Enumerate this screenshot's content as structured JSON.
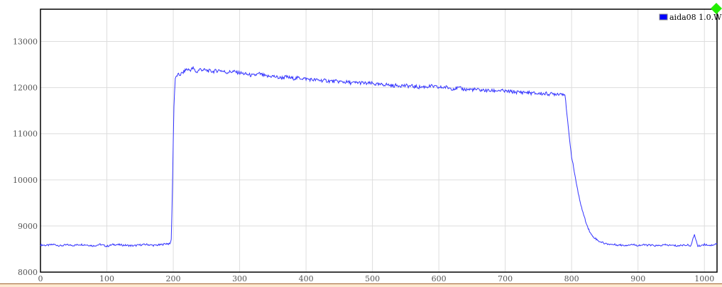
{
  "chart_data": {
    "type": "line",
    "title": "",
    "xlabel": "",
    "ylabel": "",
    "xlim": [
      0,
      1019
    ],
    "ylim": [
      8000,
      13700
    ],
    "grid": true,
    "legend_position": "top-right",
    "xticks": [
      "0",
      "100",
      "200",
      "300",
      "400",
      "500",
      "600",
      "700",
      "800",
      "900",
      "1000"
    ],
    "yticks": [
      "8000",
      "9000",
      "10000",
      "11000",
      "12000",
      "13000"
    ],
    "series": [
      {
        "name": "aida08 1.0.W",
        "color": "#3333ff",
        "x": [
          0,
          10,
          20,
          30,
          40,
          50,
          60,
          70,
          80,
          90,
          100,
          110,
          120,
          130,
          140,
          150,
          160,
          170,
          180,
          190,
          195,
          197,
          199,
          201,
          203,
          206,
          210,
          215,
          220,
          225,
          230,
          235,
          240,
          250,
          260,
          270,
          280,
          290,
          300,
          310,
          320,
          330,
          340,
          350,
          360,
          370,
          380,
          390,
          400,
          410,
          420,
          430,
          440,
          450,
          460,
          470,
          480,
          490,
          500,
          510,
          520,
          530,
          540,
          550,
          560,
          570,
          580,
          590,
          600,
          610,
          620,
          630,
          640,
          650,
          660,
          670,
          680,
          690,
          700,
          710,
          720,
          730,
          740,
          750,
          760,
          770,
          780,
          788,
          790,
          793,
          796,
          800,
          805,
          810,
          815,
          820,
          825,
          830,
          840,
          850,
          860,
          870,
          880,
          890,
          900,
          910,
          920,
          930,
          940,
          950,
          960,
          970,
          980,
          985,
          990,
          1000,
          1010,
          1019
        ],
        "y": [
          8590,
          8580,
          8600,
          8570,
          8590,
          8580,
          8600,
          8590,
          8570,
          8600,
          8560,
          8600,
          8590,
          8580,
          8570,
          8590,
          8600,
          8580,
          8590,
          8620,
          8610,
          8700,
          10000,
          11600,
          12200,
          12270,
          12280,
          12330,
          12400,
          12380,
          12420,
          12330,
          12400,
          12370,
          12350,
          12380,
          12330,
          12350,
          12320,
          12290,
          12260,
          12300,
          12240,
          12250,
          12210,
          12230,
          12200,
          12210,
          12190,
          12170,
          12160,
          12150,
          12140,
          12130,
          12120,
          12100,
          12110,
          12090,
          12090,
          12060,
          12070,
          12040,
          12050,
          12040,
          12030,
          12010,
          12020,
          12030,
          12000,
          12010,
          11980,
          11990,
          11960,
          11960,
          11950,
          11940,
          11930,
          11940,
          11920,
          11910,
          11900,
          11900,
          11880,
          11870,
          11870,
          11860,
          11870,
          11870,
          11850,
          11400,
          11000,
          10500,
          10100,
          9700,
          9400,
          9150,
          8950,
          8800,
          8680,
          8620,
          8600,
          8590,
          8580,
          8600,
          8580,
          8590,
          8580,
          8570,
          8590,
          8580,
          8570,
          8590,
          8580,
          8820,
          8560,
          8600,
          8580,
          8620
        ]
      }
    ]
  }
}
